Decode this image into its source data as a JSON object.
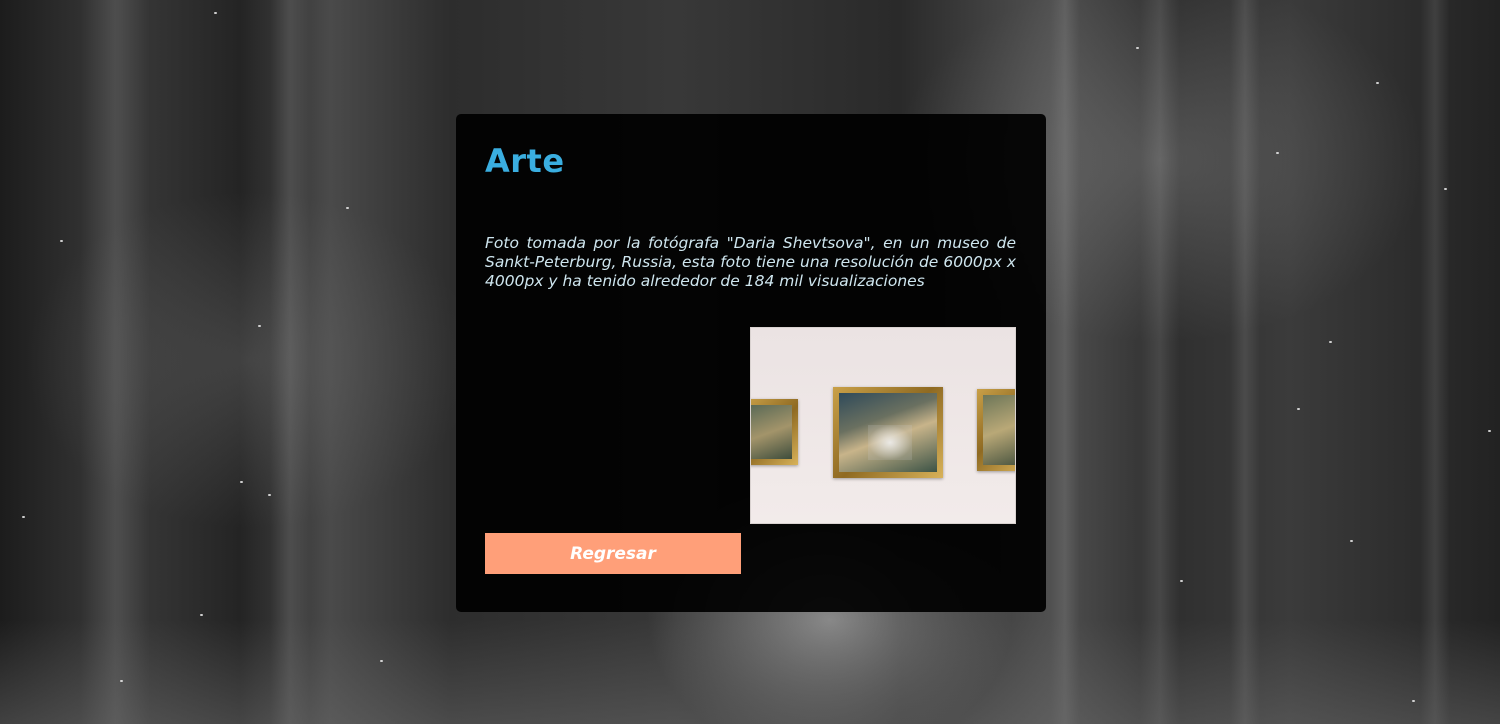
{
  "card": {
    "title": "Arte",
    "description": "Foto tomada por la fotógrafa \"Daria Shevtsova\", en un museo de Sankt-Peterburg, Russia, esta foto tiene una resolución de 6000px x 4000px y ha tenido alrededor de 184 mil visualizaciones",
    "button_label": "Regresar"
  },
  "colors": {
    "title": "#3aaee0",
    "button": "#ff9f79",
    "card_background": "#000000"
  }
}
